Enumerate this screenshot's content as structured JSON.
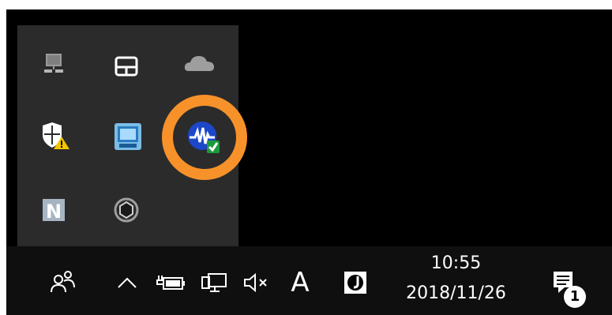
{
  "flyout": {
    "icons": [
      "network-computer-icon",
      "touchpad-icon",
      "onedrive-cloud-icon",
      "windows-security-warning-icon",
      "intel-graphics-icon",
      "highlighted-waveform-check-icon",
      "n-app-icon",
      "hex-circle-app-icon"
    ],
    "highlight_color": "#f7922a"
  },
  "taskbar": {
    "icons": [
      "people-icon",
      "show-hidden-icons-chevron-icon",
      "battery-icon",
      "network-icon",
      "volume-muted-icon",
      "ime-mode-icon",
      "j-app-icon",
      "action-center-icon"
    ],
    "ime_char": "A",
    "clock": {
      "time": "10:55",
      "date": "2018/11/26"
    },
    "notification_count": "1"
  }
}
